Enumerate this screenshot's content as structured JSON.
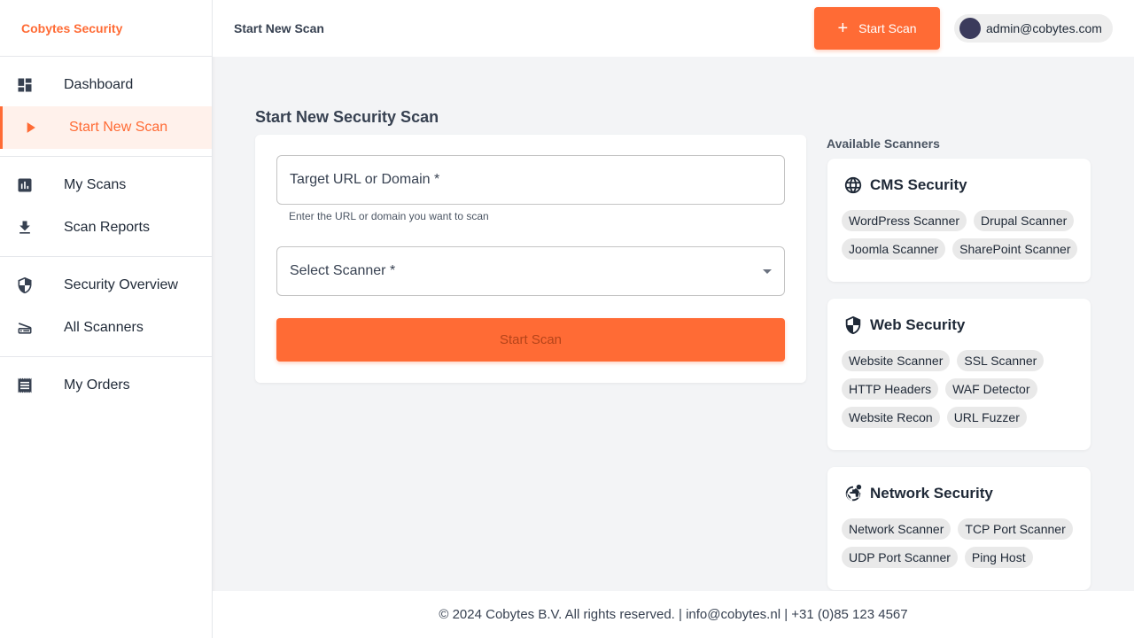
{
  "brand": "Cobytes Security",
  "nav": {
    "groups": [
      [
        {
          "label": "Dashboard",
          "icon": "dashboard-icon"
        },
        {
          "label": "Start New Scan",
          "icon": "play-icon",
          "active": true
        }
      ],
      [
        {
          "label": "My Scans",
          "icon": "bar-chart-icon"
        },
        {
          "label": "Scan Reports",
          "icon": "download-icon"
        }
      ],
      [
        {
          "label": "Security Overview",
          "icon": "shield-icon"
        },
        {
          "label": "All Scanners",
          "icon": "scanner-icon"
        }
      ],
      [
        {
          "label": "My Orders",
          "icon": "receipt-icon"
        }
      ]
    ]
  },
  "header": {
    "title": "Start New Scan",
    "start_scan_label": "Start Scan",
    "user_email": "admin@cobytes.com"
  },
  "form": {
    "title": "Start New Security Scan",
    "url_placeholder": "Target URL or Domain *",
    "url_helper": "Enter the URL or domain you want to scan",
    "scanner_placeholder": "Select Scanner *",
    "submit_label": "Start Scan"
  },
  "scanners": {
    "title": "Available Scanners",
    "cards": [
      {
        "title": "CMS Security",
        "icon": "globe-icon",
        "items": [
          "WordPress Scanner",
          "Drupal Scanner",
          "Joomla Scanner",
          "SharePoint Scanner"
        ]
      },
      {
        "title": "Web Security",
        "icon": "shield-icon",
        "items": [
          "Website Scanner",
          "SSL Scanner",
          "HTTP Headers",
          "WAF Detector",
          "Website Recon",
          "URL Fuzzer"
        ]
      },
      {
        "title": "Network Security",
        "icon": "network-globe-icon",
        "items": [
          "Network Scanner",
          "TCP Port Scanner",
          "UDP Port Scanner",
          "Ping Host"
        ]
      }
    ]
  },
  "footer": "© 2024 Cobytes B.V. All rights reserved. | info@cobytes.nl | +31 (0)85 123 4567",
  "colors": {
    "accent": "#ff6b35",
    "active_bg": "#fff1eb",
    "page_bg": "#f3f4f6"
  }
}
